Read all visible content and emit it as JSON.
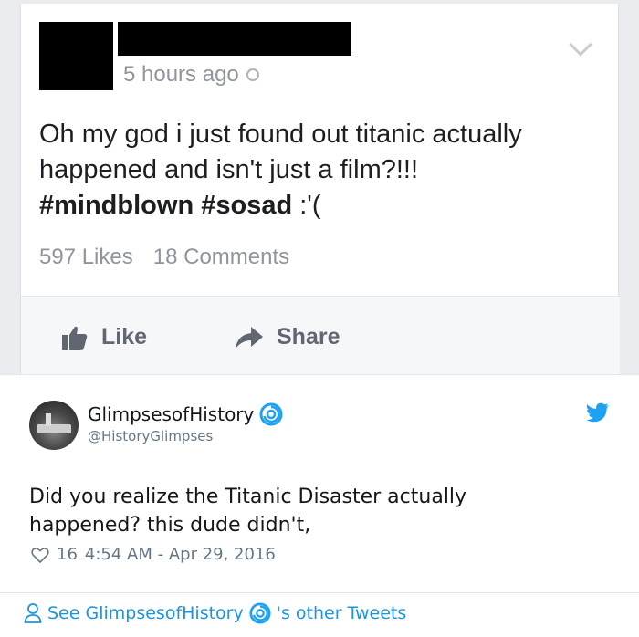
{
  "facebook_post": {
    "time_ago": "5 hours ago",
    "text_line1": "Oh my god i just found out titanic actually",
    "text_line2": "happened and isn't just a film?!!!",
    "hashtags": "#mindblown #sosad",
    "emoticon": " :'(",
    "likes_count": "597 Likes",
    "comments_count": "18 Comments",
    "like_label": "Like",
    "share_label": "Share",
    "icons": [
      "globe-icon",
      "chevron-down-icon",
      "thumbs-up-icon",
      "share-arrow-icon"
    ]
  },
  "tweet": {
    "display_name": "GlimpsesofHistory",
    "handle": "@HistoryGlimpses",
    "text_line1": "Did you realize the Titanic Disaster actually",
    "text_line2": "happened? this dude didn't,",
    "like_count": "16",
    "timestamp": "4:54 AM - Apr 29, 2016",
    "footer_prefix": "See GlimpsesofHistory",
    "footer_suffix": "'s other Tweets",
    "colors": {
      "link_blue": "#1b95e0",
      "twitter_blue": "#1da1f2",
      "muted_gray": "#657786"
    },
    "icons": [
      "verified-badge-icon",
      "twitter-bird-icon",
      "heart-icon",
      "person-icon"
    ]
  }
}
